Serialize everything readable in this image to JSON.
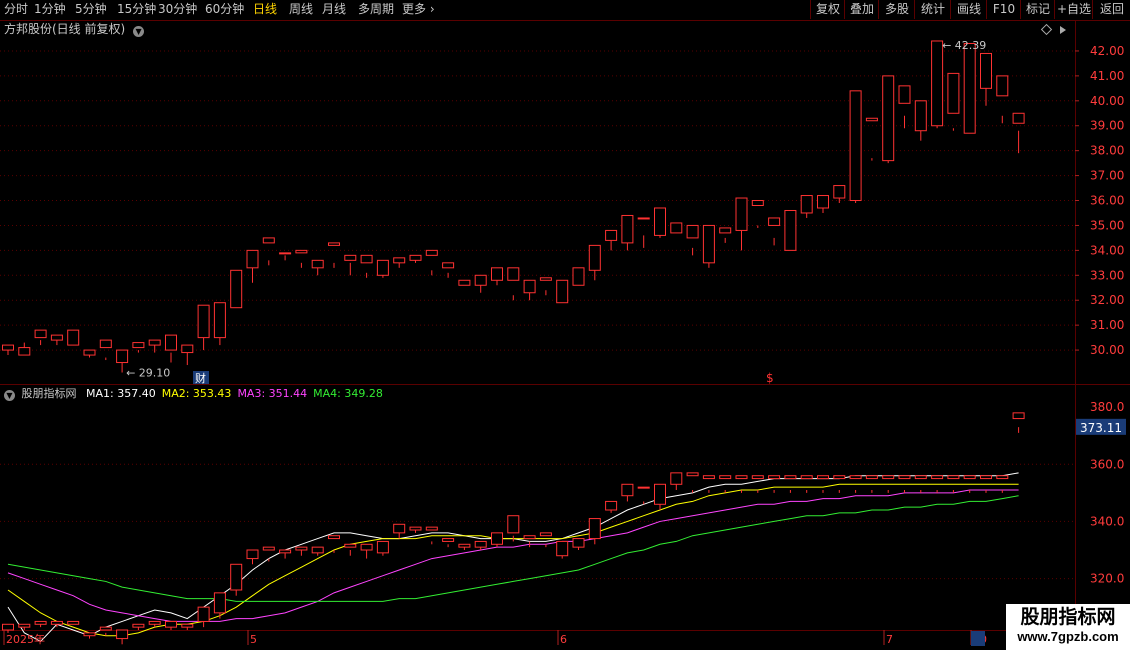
{
  "toolbar": {
    "periods": [
      "分时",
      "1分钟",
      "5分钟",
      "15分钟",
      "30分钟",
      "60分钟",
      "日线",
      "周线",
      "月线",
      "多周期",
      "更多"
    ],
    "active": "日线",
    "right_buttons": [
      "复权",
      "叠加",
      "多股",
      "统计",
      "画线",
      "F10",
      "标记",
      "+自选",
      "返回"
    ]
  },
  "main_panel": {
    "title": "方邦股份(日线 前复权)",
    "price_ticks": [
      "42.00",
      "41.00",
      "40.00",
      "39.00",
      "38.00",
      "37.00",
      "36.00",
      "35.00",
      "34.00",
      "33.00",
      "32.00",
      "31.00",
      "30.00"
    ],
    "high_label": "42.39",
    "low_label": "29.10",
    "marker_cai": "财",
    "marker_dollar": "$"
  },
  "indicator_panel": {
    "name": "股朋指标网",
    "ma_labels": [
      {
        "name": "MA1",
        "value": "357.40",
        "color": "#ffffff"
      },
      {
        "name": "MA2",
        "value": "353.43",
        "color": "#ffff00"
      },
      {
        "name": "MA3",
        "value": "351.44",
        "color": "#ff44ff"
      },
      {
        "name": "MA4",
        "value": "349.28",
        "color": "#33ee33"
      }
    ],
    "axis_ticks": [
      "360.0",
      "340.0",
      "320.0"
    ],
    "current_value": "373.11",
    "top_tick_partial": "380.0"
  },
  "date_axis": {
    "labels": [
      "2025年",
      "5",
      "6",
      "7",
      "20"
    ]
  },
  "colors": {
    "up": "#ff3232",
    "down": "#54ffff",
    "grid": "#5a0000"
  },
  "watermark": {
    "title": "股朋指标网",
    "url": "www.7gpzb.com"
  },
  "chart_data": [
    {
      "type": "candlestick",
      "title": "方邦股份(日线 前复权)",
      "ylim": [
        29.0,
        42.6
      ],
      "candles": [
        [
          30.0,
          30.2,
          29.8,
          30.0
        ],
        [
          29.8,
          30.1,
          29.9,
          30.3
        ],
        [
          30.5,
          30.8,
          30.2,
          30.4
        ],
        [
          30.4,
          30.6,
          30.2,
          30.4
        ],
        [
          30.2,
          30.8,
          29.8,
          29.8
        ],
        [
          29.8,
          30.0,
          29.7,
          29.8
        ],
        [
          30.1,
          30.4,
          29.6,
          29.7
        ],
        [
          29.5,
          30.0,
          29.1,
          29.9
        ],
        [
          30.1,
          30.3,
          29.9,
          30.0
        ],
        [
          30.2,
          30.4,
          29.9,
          30.2
        ],
        [
          30.0,
          30.6,
          29.5,
          29.9
        ],
        [
          29.9,
          30.2,
          29.4,
          29.9
        ],
        [
          30.5,
          31.8,
          30.0,
          30.6
        ],
        [
          30.5,
          31.9,
          30.2,
          31.4
        ],
        [
          31.7,
          33.2,
          31.7,
          33.0
        ],
        [
          33.3,
          34.0,
          32.7,
          33.6
        ],
        [
          34.3,
          34.5,
          33.4,
          33.6
        ],
        [
          33.9,
          33.9,
          33.6,
          33.8
        ],
        [
          33.9,
          34.0,
          33.3,
          33.5
        ],
        [
          33.3,
          33.6,
          33.0,
          33.5
        ],
        [
          34.2,
          34.3,
          33.3,
          33.5
        ],
        [
          33.6,
          33.8,
          33.0,
          33.5
        ],
        [
          33.5,
          33.8,
          32.9,
          33.1
        ],
        [
          33.0,
          33.6,
          32.9,
          33.5
        ],
        [
          33.5,
          33.7,
          33.3,
          33.6
        ],
        [
          33.6,
          33.8,
          33.5,
          33.7
        ],
        [
          33.8,
          34.0,
          33.0,
          33.2
        ],
        [
          33.3,
          33.5,
          32.9,
          33.1
        ],
        [
          32.6,
          32.8,
          32.6,
          32.7
        ],
        [
          32.6,
          33.0,
          32.3,
          32.9
        ],
        [
          32.8,
          33.3,
          32.6,
          33.2
        ],
        [
          32.8,
          33.3,
          32.0,
          32.2
        ],
        [
          32.3,
          32.8,
          32.0,
          32.7
        ],
        [
          32.8,
          32.9,
          32.2,
          32.4
        ],
        [
          31.9,
          32.8,
          31.9,
          32.5
        ],
        [
          32.6,
          33.3,
          32.6,
          33.2
        ],
        [
          33.2,
          34.2,
          32.8,
          34.1
        ],
        [
          34.4,
          34.8,
          34.0,
          34.4
        ],
        [
          34.3,
          35.4,
          34.0,
          35.3
        ],
        [
          35.3,
          35.3,
          34.1,
          34.6
        ],
        [
          34.6,
          35.7,
          34.5,
          35.1
        ],
        [
          34.7,
          35.1,
          34.6,
          34.6
        ],
        [
          34.5,
          35.0,
          33.8,
          34.1
        ],
        [
          33.5,
          35.0,
          33.3,
          34.7
        ],
        [
          34.7,
          34.9,
          34.3,
          34.5
        ],
        [
          34.8,
          36.1,
          34.0,
          36.0
        ],
        [
          35.8,
          36.0,
          34.9,
          35.0
        ],
        [
          35.0,
          35.3,
          34.2,
          34.5
        ],
        [
          34.0,
          35.6,
          34.0,
          35.5
        ],
        [
          35.5,
          36.2,
          35.3,
          35.7
        ],
        [
          35.7,
          36.2,
          35.5,
          36.0
        ],
        [
          36.1,
          36.6,
          35.9,
          36.5
        ],
        [
          36.0,
          40.4,
          35.9,
          39.2
        ],
        [
          39.2,
          39.3,
          37.6,
          37.7
        ],
        [
          37.6,
          41.0,
          37.5,
          40.1
        ],
        [
          39.9,
          40.6,
          38.9,
          39.4
        ],
        [
          38.8,
          40.0,
          38.4,
          38.9
        ],
        [
          39.0,
          42.4,
          38.9,
          39.6
        ],
        [
          39.5,
          41.1,
          38.8,
          38.9
        ],
        [
          38.7,
          42.3,
          38.7,
          40.0
        ],
        [
          40.5,
          41.9,
          39.8,
          40.5
        ],
        [
          40.2,
          41.0,
          39.1,
          39.4
        ],
        [
          39.1,
          39.5,
          37.9,
          38.8
        ]
      ]
    },
    {
      "type": "line",
      "title": "股朋指标网",
      "ylim": [
        302,
        386
      ],
      "series": [
        {
          "name": "MA1",
          "values": [
            310,
            301,
            298,
            304,
            302,
            300,
            303,
            305,
            307,
            309,
            308,
            306,
            310,
            314,
            318,
            323,
            327,
            330,
            332,
            334,
            336,
            336,
            335,
            334,
            334,
            335,
            336,
            336,
            335,
            334,
            334,
            334,
            333,
            333,
            334,
            336,
            338,
            341,
            344,
            346,
            348,
            349,
            350,
            352,
            353,
            353,
            354,
            355,
            355,
            355,
            355,
            355,
            356,
            356,
            356,
            356,
            356,
            356,
            356,
            356,
            356,
            356,
            357
          ]
        },
        {
          "name": "MA2",
          "values": [
            316,
            312,
            308,
            305,
            303,
            301,
            300,
            300,
            301,
            303,
            304,
            304,
            305,
            307,
            310,
            314,
            318,
            321,
            324,
            327,
            330,
            332,
            333,
            334,
            334,
            334,
            335,
            335,
            335,
            335,
            334,
            334,
            334,
            334,
            334,
            335,
            336,
            338,
            340,
            342,
            344,
            346,
            347,
            349,
            350,
            351,
            351,
            352,
            352,
            352,
            352,
            353,
            353,
            353,
            353,
            353,
            353,
            353,
            353,
            353,
            353,
            353,
            353
          ]
        },
        {
          "name": "MA3",
          "values": [
            322,
            320,
            318,
            316,
            314,
            311,
            309,
            308,
            307,
            306,
            305,
            305,
            305,
            305,
            306,
            306,
            307,
            308,
            310,
            312,
            315,
            317,
            319,
            321,
            323,
            325,
            327,
            328,
            329,
            330,
            331,
            331,
            332,
            332,
            333,
            333,
            334,
            335,
            336,
            338,
            340,
            341,
            342,
            343,
            344,
            345,
            346,
            346,
            347,
            347,
            348,
            348,
            349,
            349,
            349,
            350,
            350,
            350,
            350,
            351,
            351,
            351,
            351
          ]
        },
        {
          "name": "MA4",
          "values": [
            325,
            324,
            323,
            322,
            321,
            320,
            319,
            317,
            316,
            315,
            314,
            313,
            313,
            313,
            312,
            312,
            312,
            312,
            312,
            312,
            312,
            312,
            312,
            312,
            313,
            313,
            314,
            315,
            316,
            317,
            318,
            319,
            320,
            321,
            322,
            323,
            325,
            327,
            329,
            330,
            332,
            333,
            335,
            336,
            337,
            338,
            339,
            340,
            341,
            342,
            342,
            343,
            343,
            344,
            344,
            345,
            345,
            346,
            346,
            347,
            347,
            348,
            349
          ]
        }
      ],
      "bars": [
        [
          302,
          304,
          301,
          303
        ],
        [
          303,
          304,
          302,
          303
        ],
        [
          304,
          305,
          303,
          304
        ],
        [
          304,
          305,
          303,
          304
        ],
        [
          304,
          305,
          300,
          300
        ],
        [
          300,
          301,
          299,
          300
        ],
        [
          302,
          303,
          300,
          301
        ],
        [
          299,
          302,
          297,
          301
        ],
        [
          303,
          304,
          302,
          303
        ],
        [
          304,
          305,
          303,
          304
        ],
        [
          303,
          305,
          302,
          303
        ],
        [
          303,
          304,
          302,
          303
        ],
        [
          305,
          310,
          303,
          305
        ],
        [
          308,
          315,
          306,
          311
        ],
        [
          316,
          325,
          314,
          323
        ],
        [
          327,
          330,
          325,
          328
        ],
        [
          330,
          331,
          326,
          327
        ],
        [
          329,
          330,
          327,
          329
        ],
        [
          330,
          331,
          328,
          330
        ],
        [
          329,
          331,
          328,
          330
        ],
        [
          334,
          335,
          329,
          330
        ],
        [
          331,
          332,
          328,
          330
        ],
        [
          330,
          332,
          327,
          330
        ],
        [
          329,
          333,
          328,
          333
        ],
        [
          336,
          339,
          334,
          338
        ],
        [
          337,
          338,
          336,
          337
        ],
        [
          337,
          338,
          332,
          333
        ],
        [
          333,
          334,
          331,
          332
        ],
        [
          331,
          332,
          330,
          331
        ],
        [
          331,
          333,
          330,
          333
        ],
        [
          332,
          336,
          331,
          336
        ],
        [
          336,
          342,
          333,
          335
        ],
        [
          334,
          335,
          331,
          333
        ],
        [
          335,
          336,
          331,
          332
        ],
        [
          328,
          333,
          327,
          332
        ],
        [
          331,
          334,
          330,
          333
        ],
        [
          334,
          341,
          332,
          340
        ],
        [
          344,
          347,
          343,
          346
        ],
        [
          349,
          353,
          347,
          352
        ],
        [
          352,
          352,
          346,
          347
        ],
        [
          346,
          353,
          344,
          349
        ],
        [
          353,
          357,
          351,
          355
        ],
        [
          356,
          357,
          350,
          351
        ],
        [
          355,
          356,
          350,
          351
        ],
        [
          355,
          356,
          350,
          351
        ],
        [
          355,
          356,
          350,
          351
        ],
        [
          355,
          356,
          350,
          351
        ],
        [
          355,
          356,
          350,
          351
        ],
        [
          355,
          356,
          350,
          351
        ],
        [
          355,
          356,
          350,
          351
        ],
        [
          355,
          356,
          350,
          351
        ],
        [
          355,
          356,
          350,
          351
        ],
        [
          355,
          356,
          350,
          351
        ],
        [
          355,
          356,
          350,
          351
        ],
        [
          355,
          356,
          350,
          351
        ],
        [
          355,
          356,
          350,
          351
        ],
        [
          355,
          356,
          350,
          351
        ],
        [
          355,
          356,
          350,
          351
        ],
        [
          355,
          356,
          350,
          351
        ],
        [
          355,
          356,
          350,
          351
        ],
        [
          355,
          356,
          350,
          351
        ],
        [
          355,
          356,
          350,
          351
        ],
        [
          376,
          378,
          371,
          373
        ]
      ]
    }
  ]
}
